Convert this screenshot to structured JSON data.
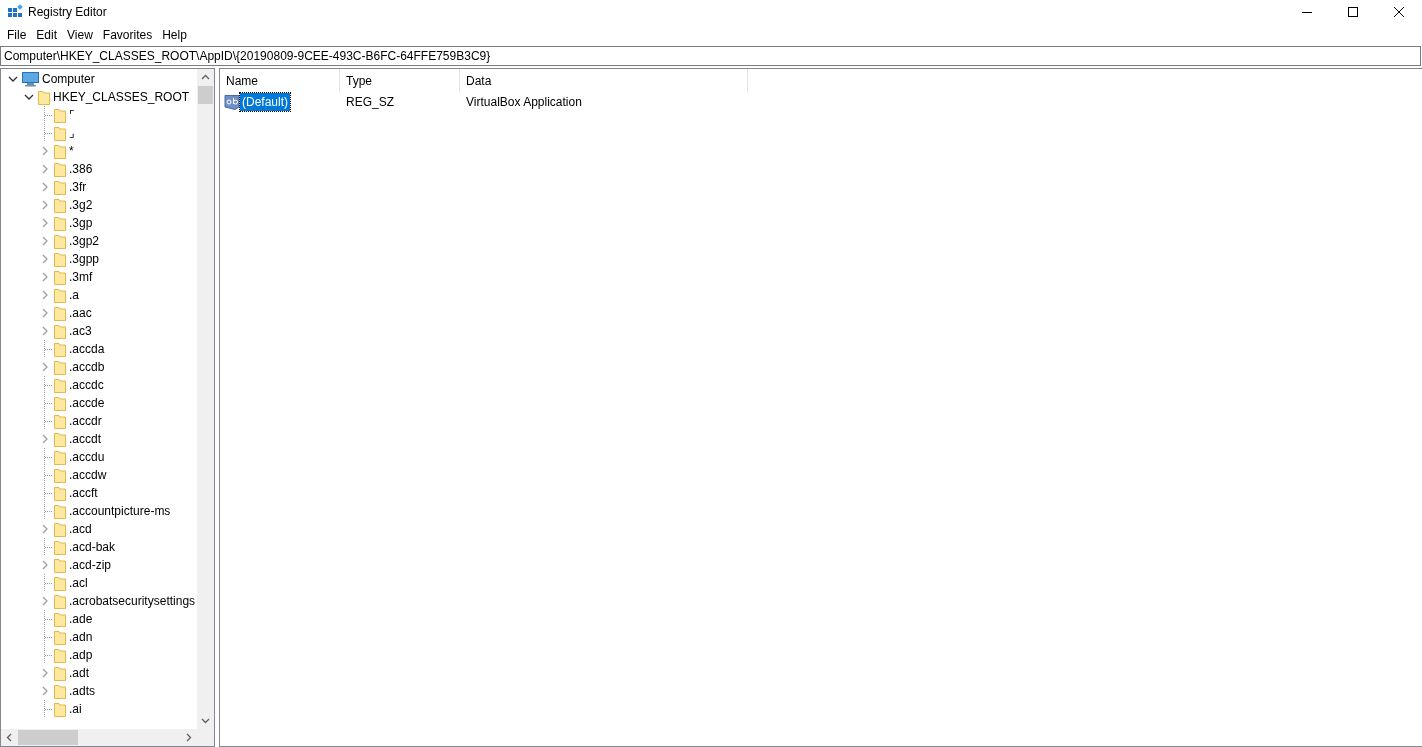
{
  "window": {
    "title": "Registry Editor"
  },
  "menu": [
    "File",
    "Edit",
    "View",
    "Favorites",
    "Help"
  ],
  "address": "Computer\\HKEY_CLASSES_ROOT\\AppID\\{20190809-9CEE-493C-B6FC-64FFE759B3C9}",
  "tree": [
    {
      "label": "Computer",
      "expandable": true,
      "expanded": true,
      "kind": "computer",
      "children": [
        {
          "label": "HKEY_CLASSES_ROOT",
          "expandable": true,
          "expanded": true,
          "children": [
            {
              "label": "⌜",
              "expandable": false
            },
            {
              "label": "⌟",
              "expandable": false
            },
            {
              "label": "*",
              "expandable": true,
              "expanded": false
            },
            {
              "label": ".386",
              "expandable": true,
              "expanded": false
            },
            {
              "label": ".3fr",
              "expandable": true,
              "expanded": false
            },
            {
              "label": ".3g2",
              "expandable": true,
              "expanded": false
            },
            {
              "label": ".3gp",
              "expandable": true,
              "expanded": false
            },
            {
              "label": ".3gp2",
              "expandable": true,
              "expanded": false
            },
            {
              "label": ".3gpp",
              "expandable": true,
              "expanded": false
            },
            {
              "label": ".3mf",
              "expandable": true,
              "expanded": false
            },
            {
              "label": ".a",
              "expandable": true,
              "expanded": false
            },
            {
              "label": ".aac",
              "expandable": true,
              "expanded": false
            },
            {
              "label": ".ac3",
              "expandable": true,
              "expanded": false
            },
            {
              "label": ".accda",
              "expandable": false
            },
            {
              "label": ".accdb",
              "expandable": true,
              "expanded": false
            },
            {
              "label": ".accdc",
              "expandable": false
            },
            {
              "label": ".accde",
              "expandable": false
            },
            {
              "label": ".accdr",
              "expandable": false
            },
            {
              "label": ".accdt",
              "expandable": true,
              "expanded": false
            },
            {
              "label": ".accdu",
              "expandable": false
            },
            {
              "label": ".accdw",
              "expandable": false
            },
            {
              "label": ".accft",
              "expandable": false
            },
            {
              "label": ".accountpicture-ms",
              "expandable": false
            },
            {
              "label": ".acd",
              "expandable": true,
              "expanded": false
            },
            {
              "label": ".acd-bak",
              "expandable": false
            },
            {
              "label": ".acd-zip",
              "expandable": true,
              "expanded": false
            },
            {
              "label": ".acl",
              "expandable": false
            },
            {
              "label": ".acrobatsecuritysettings",
              "expandable": true,
              "expanded": false
            },
            {
              "label": ".ade",
              "expandable": false
            },
            {
              "label": ".adn",
              "expandable": false
            },
            {
              "label": ".adp",
              "expandable": false
            },
            {
              "label": ".adt",
              "expandable": true,
              "expanded": false
            },
            {
              "label": ".adts",
              "expandable": true,
              "expanded": false
            },
            {
              "label": ".ai",
              "expandable": false
            }
          ]
        }
      ]
    }
  ],
  "values": {
    "columns": [
      "Name",
      "Type",
      "Data"
    ],
    "rows": [
      {
        "name": "(Default)",
        "type": "REG_SZ",
        "data": "VirtualBox Application",
        "selected": true
      }
    ]
  }
}
